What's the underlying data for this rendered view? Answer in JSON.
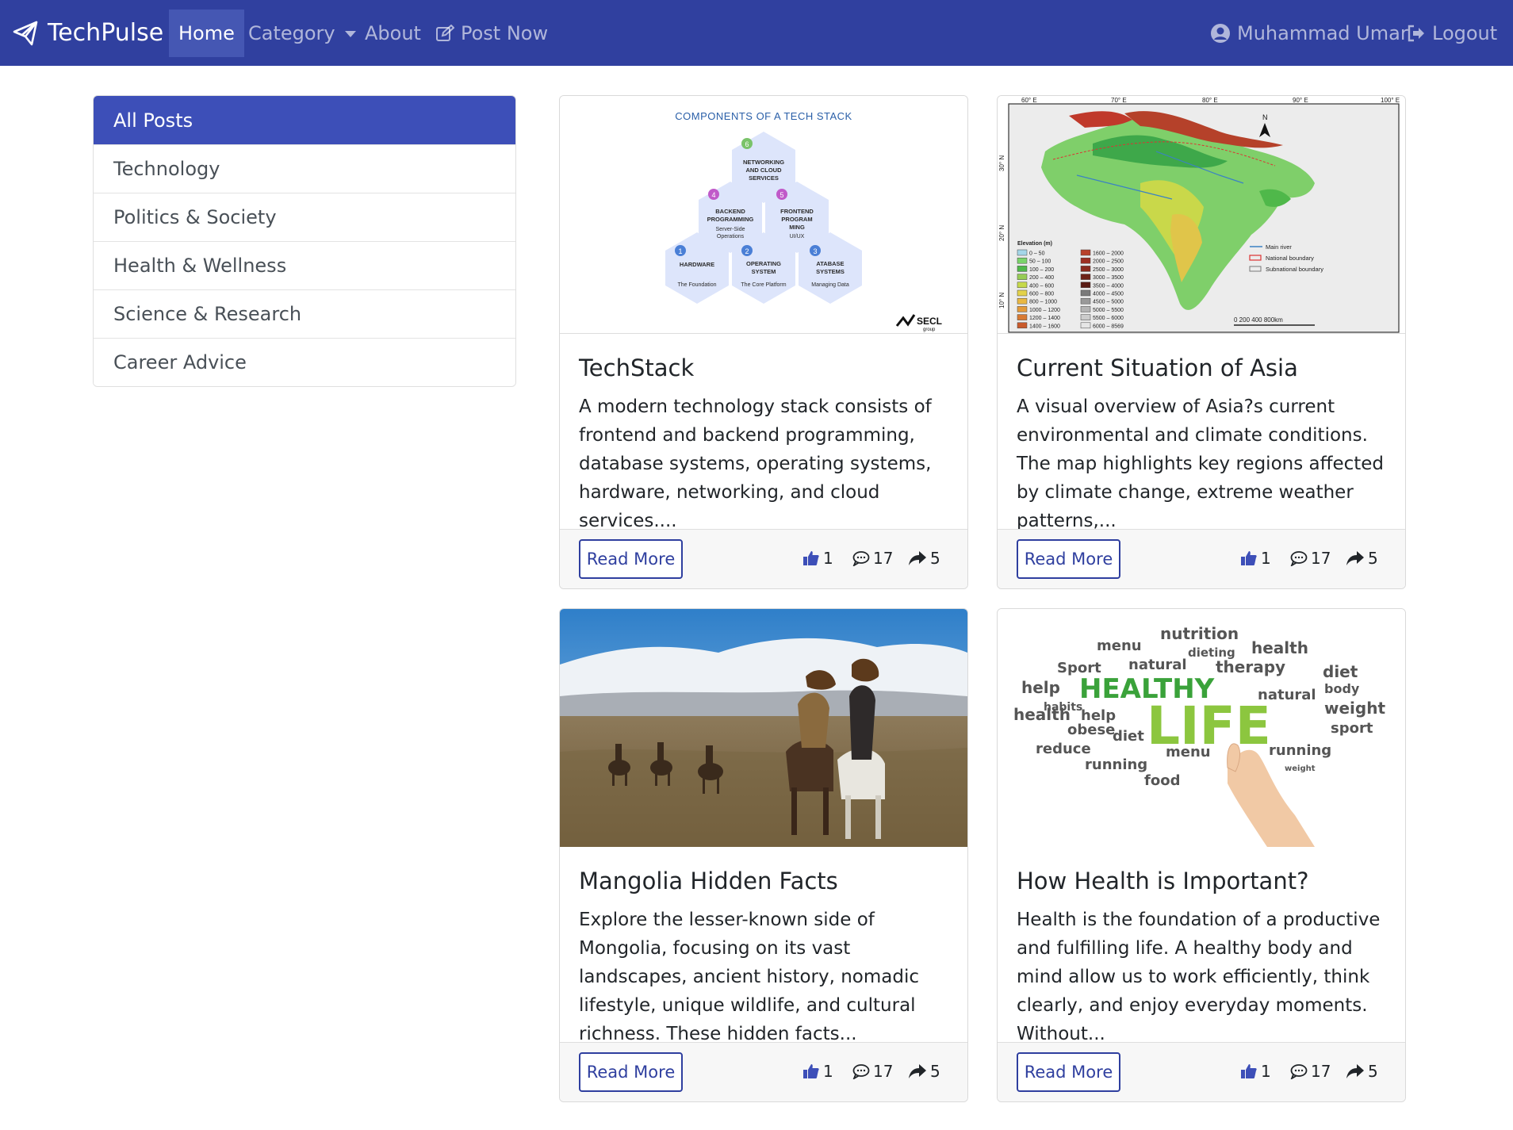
{
  "navbar": {
    "brand": "TechPulse",
    "items": [
      {
        "label": "Home"
      },
      {
        "label": "Category"
      },
      {
        "label": "About"
      },
      {
        "label": "Post Now"
      }
    ],
    "user": "Muhammad Umar",
    "logout": "Logout"
  },
  "sidebar": {
    "items": [
      {
        "label": "All Posts"
      },
      {
        "label": "Technology"
      },
      {
        "label": "Politics & Society"
      },
      {
        "label": "Health & Wellness"
      },
      {
        "label": "Science & Research"
      },
      {
        "label": "Career Advice"
      }
    ]
  },
  "posts": [
    {
      "title": "TechStack",
      "excerpt": "A modern technology stack consists of frontend and backend programming, database systems, operating systems, hardware, networking, and cloud services....",
      "read_more": "Read More",
      "likes": "1",
      "comments": "17",
      "shares": "5",
      "image": {
        "heading": "COMPONENTS OF A TECH STACK",
        "hexes": [
          {
            "num": "6",
            "title": "NETWORKING AND CLOUD SERVICES",
            "sub": ""
          },
          {
            "num": "4",
            "title": "BACKEND PROGRAMMING",
            "sub": "Server-Side Operations"
          },
          {
            "num": "5",
            "title": "FRONTEND PROGRAM MING",
            "sub": "UI/UX"
          },
          {
            "num": "1",
            "title": "HARDWARE",
            "sub": "The Foundation"
          },
          {
            "num": "2",
            "title": "OPERATING SYSTEM",
            "sub": "The Core Platform"
          },
          {
            "num": "3",
            "title": "ATABASE SYSTEMS",
            "sub": "Managing Data"
          }
        ],
        "logo": "SECL",
        "logo_sub": "group"
      }
    },
    {
      "title": "Current Situation of Asia",
      "excerpt": "A visual overview of Asia?s current environmental and climate conditions. The map highlights key regions affected by climate change, extreme weather patterns,...",
      "read_more": "Read More",
      "likes": "1",
      "comments": "17",
      "shares": "5",
      "image": {
        "lon_labels": [
          "60° E",
          "70° E",
          "80° E",
          "90° E",
          "100° E"
        ],
        "lat_labels": [
          "30° N",
          "20° N",
          "10° N"
        ],
        "legend_title": "Elevation (m)",
        "legend_left": [
          "0 – 50",
          "50 – 100",
          "100 – 200",
          "200 – 400",
          "400 – 600",
          "600 – 800",
          "800 – 1000",
          "1000 – 1200",
          "1200 – 1400",
          "1400 – 1600"
        ],
        "legend_right": [
          "1600 – 2000",
          "2000 – 2500",
          "2500 – 3000",
          "3000 – 3500",
          "3500 – 4000",
          "4000 – 4500",
          "4500 – 5000",
          "5000 – 5500",
          "5500 – 6000",
          "6000 – 8569"
        ],
        "legend_left_colors": [
          "#a5d6e8",
          "#7bd46b",
          "#4fb84a",
          "#97cc55",
          "#c6d94a",
          "#e3d24a",
          "#e9b842",
          "#e39a3a",
          "#d87a33",
          "#c95a2b"
        ],
        "legend_right_colors": [
          "#b8412a",
          "#9d2f22",
          "#8a2a1e",
          "#6e2218",
          "#5a1c14",
          "#7a7a7a",
          "#999999",
          "#b3b3b3",
          "#cccccc",
          "#e6e6e6"
        ],
        "map_legend": [
          "Main river",
          "National boundary",
          "Subnational boundary"
        ],
        "scale": "0  200 400      800km",
        "north": "N"
      }
    },
    {
      "title": "Mangolia Hidden Facts",
      "excerpt": "Explore the lesser-known side of Mongolia, focusing on its vast landscapes, ancient history, nomadic lifestyle, unique wildlife, and cultural richness. These hidden facts...",
      "read_more": "Read More",
      "likes": "1",
      "comments": "17",
      "shares": "5"
    },
    {
      "title": "How Health is Important?",
      "excerpt": "Health is the foundation of a productive and fulfilling life. A healthy body and mind allow us to work efficiently, think clearly, and enjoy everyday moments. Without...",
      "read_more": "Read More",
      "likes": "1",
      "comments": "17",
      "shares": "5",
      "image": {
        "words": [
          "nutrition",
          "menu",
          "health",
          "dieting",
          "Sport",
          "natural",
          "therapy",
          "diet",
          "help",
          "HEALTHY",
          "body",
          "habits",
          "natural",
          "weight",
          "health",
          "help",
          "LIFE",
          "obese",
          "diet",
          "sport",
          "reduce",
          "menu",
          "running",
          "running",
          "food",
          "weight"
        ]
      }
    }
  ],
  "colors": {
    "navbar": "#30409f",
    "active_nav": "#4557b3",
    "sidebar_active": "#3d4fb8",
    "button_border": "#2f3f9f"
  },
  "icons": {
    "brand": "paper-plane-icon",
    "post_now": "edit-icon",
    "user": "user-circle-icon",
    "logout": "sign-out-icon",
    "like": "thumbs-up-icon",
    "comment": "comment-icon",
    "share": "share-icon"
  }
}
